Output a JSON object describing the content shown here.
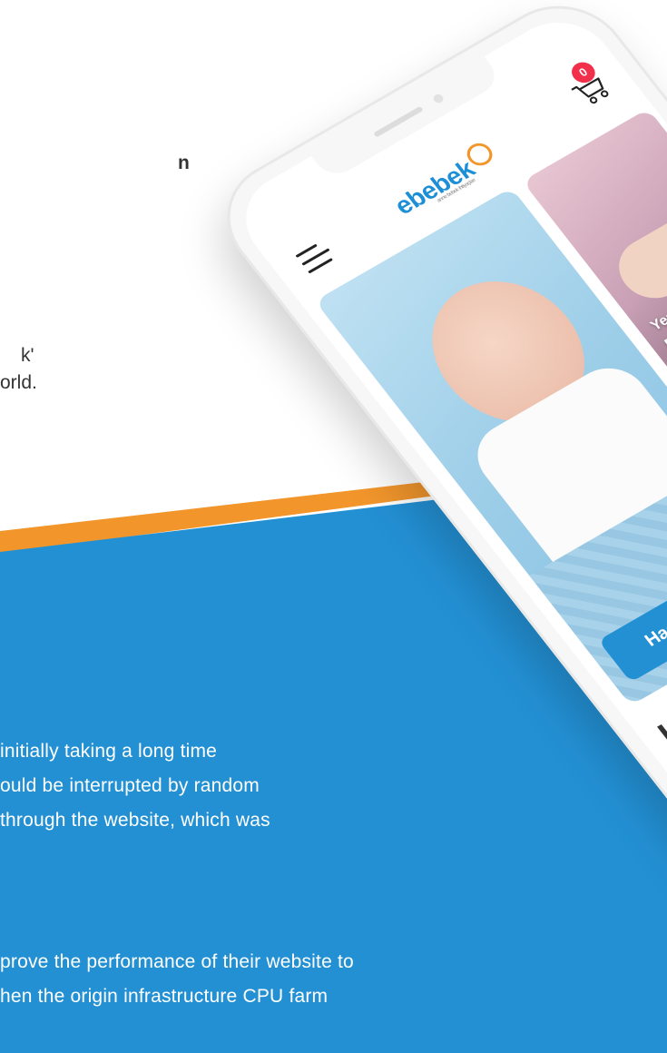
{
  "background_text": {
    "top_fragments": [
      {
        "text": "n",
        "bold": true
      },
      {
        "text": "k'",
        "bold": false
      },
      {
        "text": "orld.",
        "bold": false
      }
    ],
    "paragraph1_lines": [
      "initially taking a long time",
      "ould be interrupted by random",
      "through the website, which was"
    ],
    "paragraph2_lines": [
      "prove the performance of their website to",
      "hen the origin infrastructure CPU farm"
    ]
  },
  "phone_app": {
    "logo_text": "ebebek",
    "logo_tagline": "anne bebek ihtiyaçları",
    "cart_count": "0",
    "tiles": {
      "main_label": "Hastane Çıkışı",
      "top_right_label": "Yenidoğan Bebek Bezi",
      "mid_right_label": ""
    },
    "section_heading": "Haftan"
  },
  "colors": {
    "brand_blue": "#2390d4",
    "brand_orange": "#f2962c",
    "badge_red": "#f2304b"
  },
  "icons": [
    "menu-icon",
    "cart-icon",
    "chevron-right-icon"
  ]
}
